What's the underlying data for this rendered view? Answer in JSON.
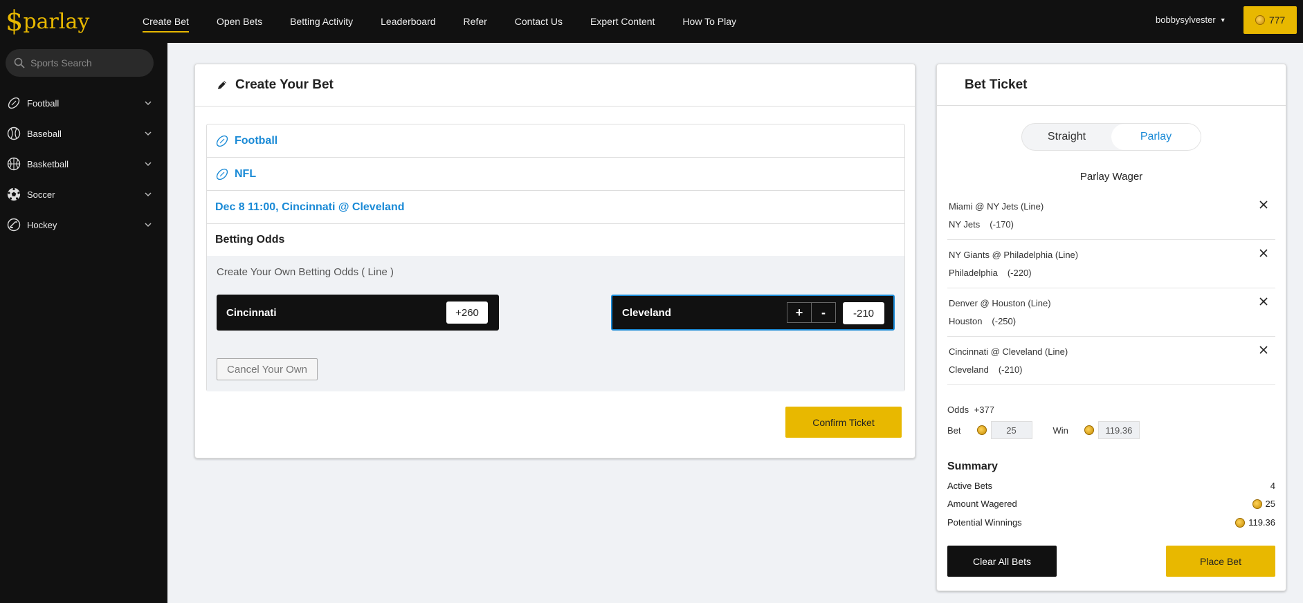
{
  "app": {
    "logo_mark": "$",
    "logo_text": "parlay",
    "brand_color": "#e8b800",
    "link_color": "#1a8ad6"
  },
  "nav": {
    "items": [
      {
        "label": "Create Bet",
        "active": true
      },
      {
        "label": "Open Bets"
      },
      {
        "label": "Betting Activity"
      },
      {
        "label": "Leaderboard"
      },
      {
        "label": "Refer"
      },
      {
        "label": "Contact Us"
      },
      {
        "label": "Expert Content"
      },
      {
        "label": "How To Play"
      }
    ],
    "username": "bobbysylvester",
    "coin_balance": "777"
  },
  "sidebar": {
    "search_placeholder": "Sports Search",
    "items": [
      {
        "label": "Football",
        "icon": "football-icon"
      },
      {
        "label": "Baseball",
        "icon": "baseball-icon"
      },
      {
        "label": "Basketball",
        "icon": "basketball-icon"
      },
      {
        "label": "Soccer",
        "icon": "soccer-icon"
      },
      {
        "label": "Hockey",
        "icon": "hockey-icon"
      }
    ]
  },
  "create_bet": {
    "title": "Create Your Bet",
    "breadcrumb": {
      "sport": "Football",
      "league": "NFL",
      "game": "Dec 8 11:00, Cincinnati @ Cleveland",
      "section": "Betting Odds"
    },
    "own_odds_label": "Create Your Own Betting Odds ( Line )",
    "team_a": {
      "name": "Cincinnati",
      "odds": "+260"
    },
    "team_b": {
      "name": "Cleveland",
      "odds": "-210",
      "plus": "+",
      "minus": "-"
    },
    "cancel_label": "Cancel Your Own",
    "confirm_label": "Confirm Ticket"
  },
  "ticket": {
    "title": "Bet Ticket",
    "tabs": {
      "straight": "Straight",
      "parlay": "Parlay",
      "active": "Parlay"
    },
    "wager_title": "Parlay Wager",
    "legs": [
      {
        "match": "Miami @ NY Jets (Line)",
        "team": "NY Jets",
        "odds": "(-170)"
      },
      {
        "match": "NY Giants @ Philadelphia (Line)",
        "team": "Philadelphia",
        "odds": "(-220)"
      },
      {
        "match": "Denver @ Houston (Line)",
        "team": "Houston",
        "odds": "(-250)"
      },
      {
        "match": "Cincinnati @ Cleveland (Line)",
        "team": "Cleveland",
        "odds": "(-210)"
      }
    ],
    "odds_label": "Odds",
    "odds_value": "+377",
    "bet_label": "Bet",
    "bet_value": "25",
    "win_label": "Win",
    "win_value": "119.36",
    "summary": {
      "title": "Summary",
      "active_bets_label": "Active Bets",
      "active_bets": "4",
      "amount_wagered_label": "Amount Wagered",
      "amount_wagered": "25",
      "potential_winnings_label": "Potential Winnings",
      "potential_winnings": "119.36"
    },
    "clear_label": "Clear All Bets",
    "place_label": "Place Bet"
  }
}
